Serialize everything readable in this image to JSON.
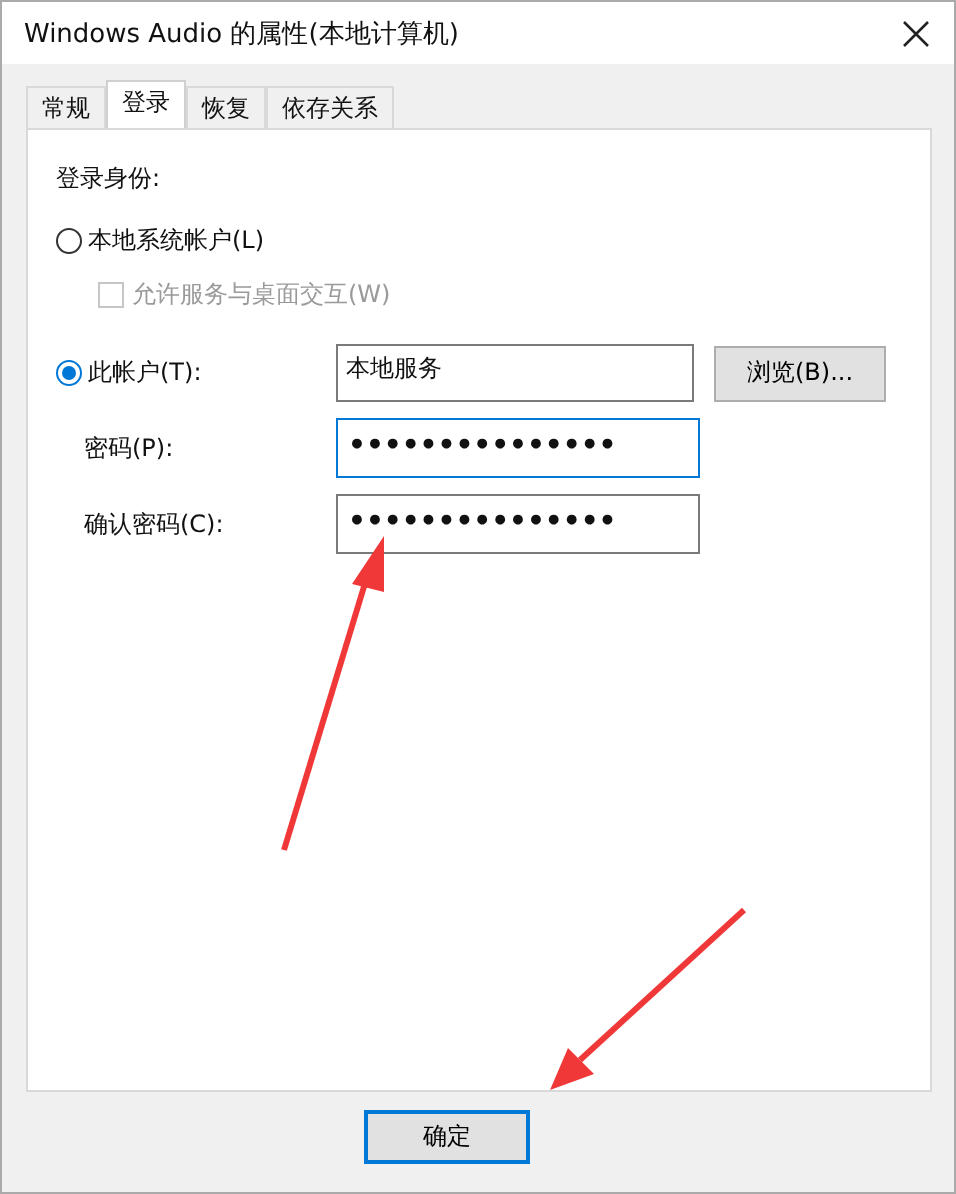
{
  "window": {
    "title": "Windows Audio 的属性(本地计算机)"
  },
  "tabs": [
    {
      "label": "常规",
      "selected": false
    },
    {
      "label": "登录",
      "selected": true
    },
    {
      "label": "恢复",
      "selected": false
    },
    {
      "label": "依存关系",
      "selected": false
    }
  ],
  "logon_as": {
    "label": "登录身份:",
    "local_system": {
      "label": "本地系统帐户(L)",
      "selected": false
    },
    "allow_desktop": {
      "label": "允许服务与桌面交互(W)",
      "checked": false,
      "disabled": true
    },
    "this_account": {
      "label": "此帐户(T):",
      "selected": true,
      "value": "本地服务",
      "browse": "浏览(B)..."
    },
    "password": {
      "label": "密码(P):",
      "value": "•••••••••••••••",
      "focused": true
    },
    "confirm_password": {
      "label": "确认密码(C):",
      "value": "•••••••••••••••",
      "focused": false
    }
  },
  "buttons": [
    "确定"
  ]
}
